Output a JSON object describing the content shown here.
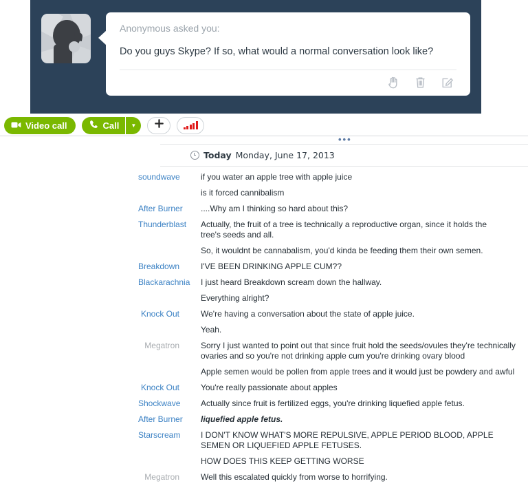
{
  "ask": {
    "avatar_alt": "anonymous-avatar",
    "label": "Anonymous asked you:",
    "question": "Do you guys Skype? If so, what would a normal conversation look like?",
    "actions": [
      {
        "name": "hand-icon",
        "title": "hand"
      },
      {
        "name": "trash-icon",
        "title": "delete"
      },
      {
        "name": "compose-icon",
        "title": "answer"
      }
    ],
    "panel_color": "#2c4259"
  },
  "toolbar": {
    "video_call_label": "Video call",
    "call_label": "Call",
    "caret_label": "▼",
    "add_label": "+",
    "signal_name": "signal-bars-icon",
    "green": "#7ab800",
    "signal_color": "#e01b1b"
  },
  "chat": {
    "ellipsis": "•••",
    "date_today": "Today",
    "date_full": "Monday, June 17, 2013",
    "name_color": "#3c82c4",
    "muted_name_color": "#a8acb0",
    "messages": [
      {
        "who": "soundwave",
        "text": "if you water an apple tree with apple juice",
        "muted": false,
        "style": "normal",
        "wide": false
      },
      {
        "who": "",
        "text": "is it forced cannibalism",
        "muted": false,
        "style": "normal",
        "wide": false
      },
      {
        "who": "After Burner",
        "text": "....Why am I thinking so hard about this?",
        "muted": false,
        "style": "normal",
        "wide": false
      },
      {
        "who": "Thunderblast",
        "text": "Actually, the fruit of a tree is technically a reproductive organ, since it holds the tree's seeds and all.",
        "muted": false,
        "style": "normal",
        "wide": false
      },
      {
        "who": "",
        "text": "So, it wouldnt be cannabalism, you'd kinda be feeding them their own semen.",
        "muted": false,
        "style": "normal",
        "wide": false
      },
      {
        "who": "Breakdown",
        "text": "I'VE BEEN DRINKING APPLE CUM??",
        "muted": false,
        "style": "normal",
        "wide": false
      },
      {
        "who": "Blackarachnia",
        "text": "I just heard Breakdown scream down the hallway.",
        "muted": false,
        "style": "normal",
        "wide": false
      },
      {
        "who": "",
        "text": "Everything alright?",
        "muted": false,
        "style": "normal",
        "wide": false
      },
      {
        "who": "Knock Out",
        "text": "We're having a conversation about the state of apple juice.",
        "muted": false,
        "style": "normal",
        "wide": false
      },
      {
        "who": "",
        "text": "Yeah.",
        "muted": false,
        "style": "normal",
        "wide": false
      },
      {
        "who": "Megatron",
        "text": "Sorry I just wanted to point out that since fruit hold the seeds/ovules they're technically ovaries and so you're not drinking apple cum you're drinking ovary blood",
        "muted": true,
        "style": "normal",
        "wide": true
      },
      {
        "who": "",
        "text": "Apple semen would be pollen from apple trees and it would just be powdery and awful",
        "muted": false,
        "style": "normal",
        "wide": true
      },
      {
        "who": "Knock Out",
        "text": "You're really passionate about apples",
        "muted": false,
        "style": "normal",
        "wide": false
      },
      {
        "who": "Shockwave",
        "text": "Actually since fruit is fertilized eggs, you're drinking liquefied apple fetus.",
        "muted": false,
        "style": "normal",
        "wide": true
      },
      {
        "who": "After Burner",
        "text": "liquefied apple fetus.",
        "muted": false,
        "style": "bolditalic",
        "wide": false
      },
      {
        "who": "Starscream",
        "text": "I DON'T KNOW WHAT'S MORE REPULSIVE, APPLE PERIOD BLOOD, APPLE SEMEN OR LIQUEFIED APPLE FETUSES.",
        "muted": false,
        "style": "normal",
        "wide": false
      },
      {
        "who": "",
        "text": "HOW DOES THIS KEEP GETTING WORSE",
        "muted": false,
        "style": "normal",
        "wide": false
      },
      {
        "who": "Megatron",
        "text": "Well this escalated quickly from worse to horrifying.",
        "muted": true,
        "style": "normal",
        "wide": false
      }
    ]
  }
}
